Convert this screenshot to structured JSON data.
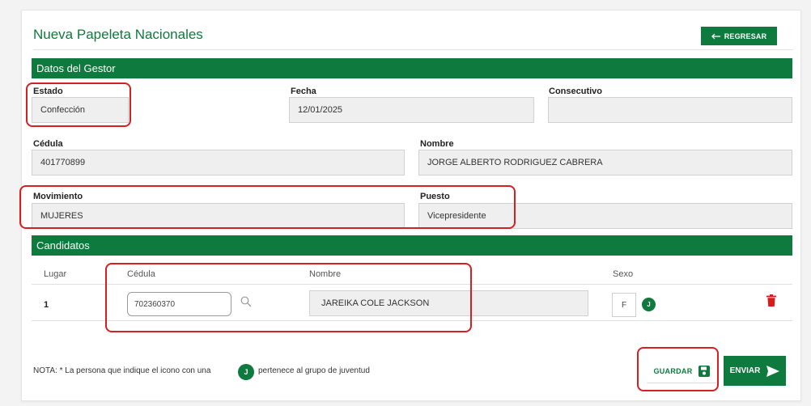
{
  "header": {
    "title": "Nueva Papeleta Nacionales",
    "back_label": "REGRESAR"
  },
  "colors": {
    "brand_green": "#0e7a3d",
    "highlight_red": "#d42020",
    "delete_red": "#d81b1b"
  },
  "datos_gestor": {
    "section_title": "Datos del Gestor",
    "estado": {
      "label": "Estado",
      "value": "Confección"
    },
    "fecha": {
      "label": "Fecha",
      "value": "12/01/2025"
    },
    "consecutivo": {
      "label": "Consecutivo",
      "value": ""
    },
    "cedula": {
      "label": "Cédula",
      "value": "401770899"
    },
    "nombre": {
      "label": "Nombre",
      "value": "JORGE ALBERTO RODRIGUEZ CABRERA"
    },
    "movimiento": {
      "label": "Movimiento",
      "value": "MUJERES"
    },
    "puesto": {
      "label": "Puesto",
      "value": "Vicepresidente"
    }
  },
  "candidatos": {
    "section_title": "Candidatos",
    "columns": [
      "Lugar",
      "Cédula",
      "Nombre",
      "Sexo"
    ],
    "rows": [
      {
        "lugar": "1",
        "cedula": "702360370",
        "nombre": "JAREIKA COLE JACKSON",
        "sexo": "F",
        "badge": "J"
      }
    ]
  },
  "footer": {
    "nota_prefix": "NOTA: * La persona que indique el icono con una",
    "badge": "J",
    "nota_suffix": "pertenece al grupo de juventud",
    "guardar_label": "GUARDAR",
    "enviar_label": "ENVIAR"
  },
  "icons": [
    "arrow-left-icon",
    "search-icon",
    "junior-badge-icon",
    "trash-icon",
    "save-icon",
    "send-icon"
  ]
}
